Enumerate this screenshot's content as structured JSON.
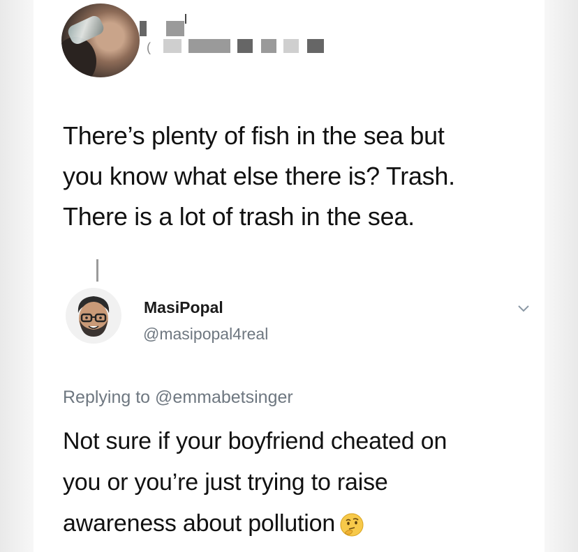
{
  "original_tweet": {
    "text_lines": [
      "There’s plenty of fish in the sea but",
      "you know what else there is? Trash.",
      "There is a lot of trash in the sea."
    ]
  },
  "reply": {
    "display_name": "MasiPopal",
    "handle": "@masipopal4real",
    "replying_prefix": "Replying to",
    "replying_to": "@emmabetsinger",
    "text_lines": [
      "Not sure if your boyfriend cheated on",
      "you or you’re just trying to raise",
      "awareness about pollution"
    ],
    "emoji": "thinking-face-icon"
  },
  "colors": {
    "text": "#111111",
    "muted": "#6e7780",
    "background": "#ffffff"
  }
}
